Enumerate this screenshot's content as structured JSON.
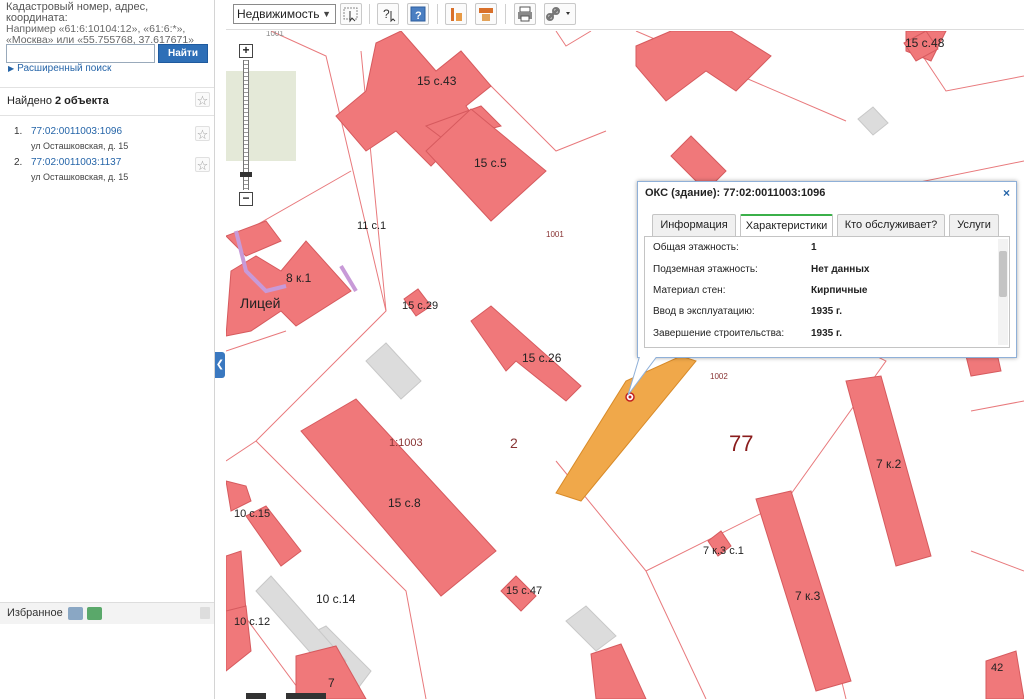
{
  "sidebar": {
    "hint_line1": "Кадастровый номер, адрес, координата:",
    "hint_line2": "Например «61:6:10104:12», «61:6:*»,",
    "hint_line3": "«Москва» или «55.755768, 37.617671»",
    "search_value": "",
    "find_label": "Найти",
    "advanced_link": "Расширенный поиск",
    "found_prefix": "Найдено",
    "found_count": "2 объекта",
    "results": [
      {
        "num": "1.",
        "cad": "77:02:0011003:1096",
        "address": "ул Осташковская, д. 15"
      },
      {
        "num": "2.",
        "cad": "77:02:0011003:1137",
        "address": "ул Осташковская, д. 15"
      }
    ],
    "favorites_label": "Избранное"
  },
  "toolbar": {
    "layer_select": "Недвижимость"
  },
  "map": {
    "labels": {
      "b1": "1001",
      "b2": "15 с.43",
      "b3": "15 с.48",
      "b4": "15 с.5",
      "b5": "11 с.1",
      "b6": "1001",
      "b7": "8 к.1",
      "b8": "Лицей",
      "b9": "15 с.29",
      "b10": "15 с.26",
      "b11": "1002",
      "b12": "1:1003",
      "b13": "2",
      "b14": "77",
      "b15": "15 с.8",
      "b16": "7 к.2",
      "b17": "10 с.15",
      "b18": "7 к.3 с.1",
      "b19": "7 к.3",
      "b20": "15 с.47",
      "b21": "10 с.14",
      "b22": "10 с.12",
      "b23": "42",
      "b24": "7"
    }
  },
  "popup": {
    "title": "ОКС (здание): 77:02:0011003:1096",
    "close": "×",
    "tabs": [
      "Информация",
      "Характеристики",
      "Кто обслуживает?",
      "Услуги"
    ],
    "active_tab": "Характеристики",
    "rows": [
      {
        "label": "Общая этажность:",
        "value": "1"
      },
      {
        "label": "Подземная этажность:",
        "value": "Нет данных"
      },
      {
        "label": "Материал стен:",
        "value": "Кирпичные"
      },
      {
        "label": "Ввод в эксплуатацию:",
        "value": "1935 г."
      },
      {
        "label": "Завершение строительства:",
        "value": "1935 г."
      }
    ]
  },
  "colors": {
    "building": "#f0787a",
    "building_stroke": "#d65a5e",
    "parcel_line": "#e8797c",
    "selected": "#f0a84a",
    "accent_blue": "#2e6fb7"
  }
}
